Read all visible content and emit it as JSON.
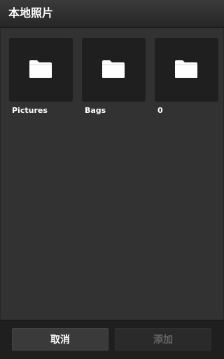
{
  "header": {
    "title": "本地照片"
  },
  "folders": [
    {
      "label": "Pictures",
      "icon": "folder-icon"
    },
    {
      "label": "Bags",
      "icon": "folder-icon"
    },
    {
      "label": "0",
      "icon": "folder-icon"
    }
  ],
  "footer": {
    "cancel_label": "取消",
    "add_label": "添加",
    "add_enabled": false
  }
}
